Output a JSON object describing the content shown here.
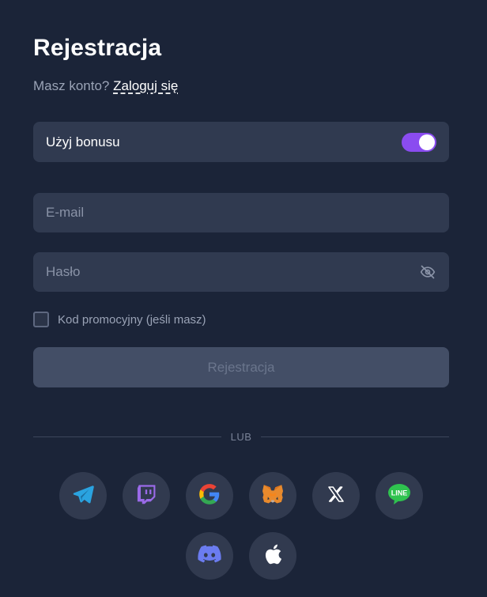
{
  "header": {
    "title": "Rejestracja",
    "subtitle_prefix": "Masz konto?",
    "login_link": "Zaloguj się"
  },
  "bonus": {
    "label": "Użyj bonusu",
    "enabled": true
  },
  "form": {
    "email_placeholder": "E-mail",
    "password_placeholder": "Hasło",
    "promo_label": "Kod promocyjny (jeśli masz)",
    "promo_checked": false,
    "submit_label": "Rejestracja"
  },
  "divider": {
    "text": "LUB"
  },
  "social_logins": [
    {
      "name": "telegram",
      "icon": "telegram-icon"
    },
    {
      "name": "twitch",
      "icon": "twitch-icon"
    },
    {
      "name": "google",
      "icon": "google-icon"
    },
    {
      "name": "metamask",
      "icon": "metamask-icon"
    },
    {
      "name": "x",
      "icon": "x-icon"
    },
    {
      "name": "line",
      "icon": "line-icon",
      "text": "LINE"
    },
    {
      "name": "discord",
      "icon": "discord-icon"
    },
    {
      "name": "apple",
      "icon": "apple-icon"
    }
  ],
  "colors": {
    "background": "#1b2438",
    "field": "#303a50",
    "toggle_on": "#8a4cf0",
    "button_disabled": "#434e66",
    "telegram": "#2aa3e0",
    "twitch": "#9a6ae8",
    "line": "#2fc24f",
    "discord": "#6b7cf0"
  }
}
